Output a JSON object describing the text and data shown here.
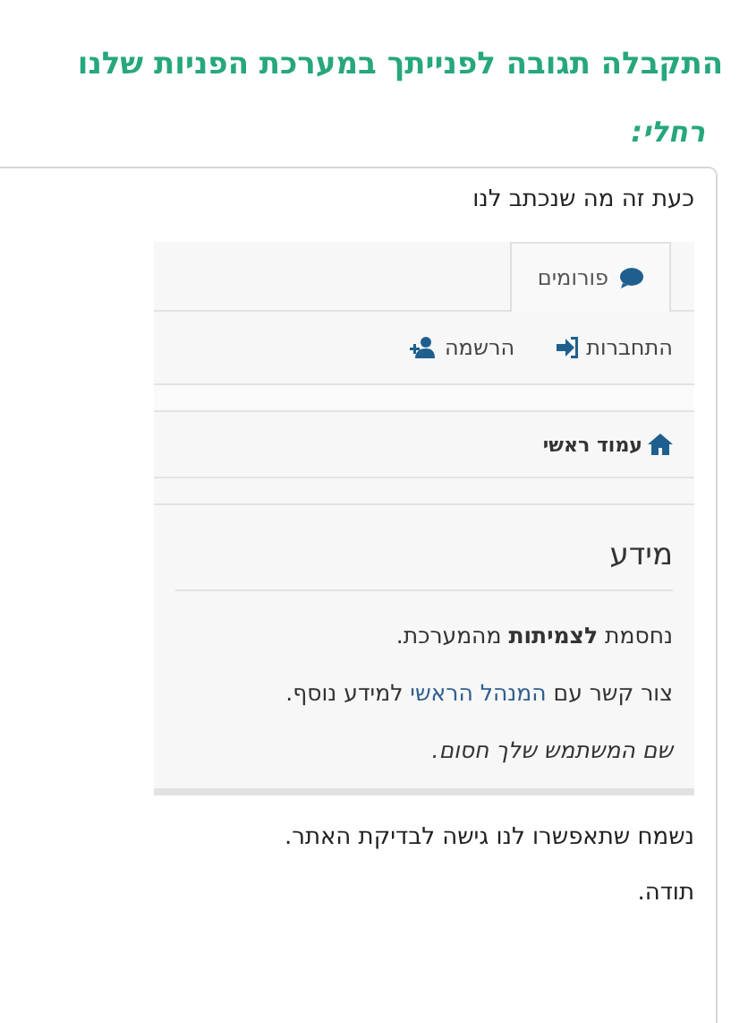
{
  "heading": "התקבלה תגובה לפנייתך במערכת הפניות שלנו",
  "author": "רחלי:",
  "message": {
    "intro": "כעת זה מה שנכתב לנו",
    "embedded": {
      "tabs": [
        {
          "label": "פורומים",
          "selected": true
        }
      ],
      "nav_links": [
        {
          "label": "התחברות",
          "kind": "login"
        },
        {
          "label": "הרשמה",
          "kind": "register"
        }
      ],
      "breadcrumb": "עמוד ראשי",
      "panel": {
        "title": "מידע",
        "lines": [
          {
            "kind": "plain",
            "text": "נחסמת **לצמיתות** מהמערכת."
          },
          {
            "kind": "link",
            "before": "צור קשר עם ",
            "link": "המנהל הראשי",
            "after": " למידע נוסף."
          },
          {
            "kind": "italic",
            "text": "שם המשתמש שלך חסום."
          }
        ]
      }
    },
    "closing": [
      "נשמח שתאפשרו לנו גישה לבדיקת האתר.",
      "תודה."
    ]
  }
}
